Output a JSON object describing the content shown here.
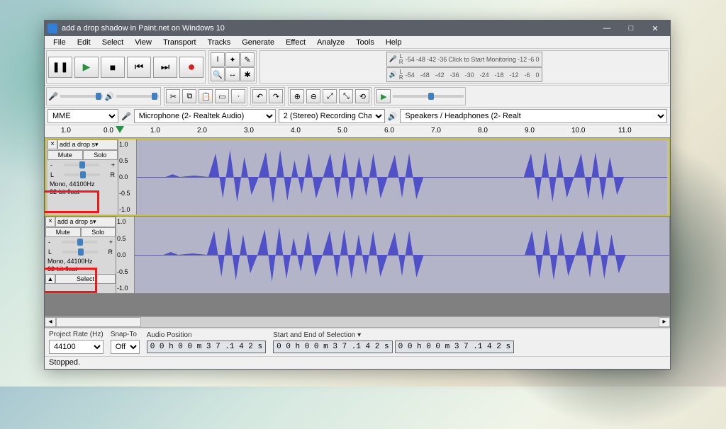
{
  "title": "add a drop shadow in Paint.net on Windows 10",
  "menu": [
    "File",
    "Edit",
    "Select",
    "View",
    "Transport",
    "Tracks",
    "Generate",
    "Effect",
    "Analyze",
    "Tools",
    "Help"
  ],
  "meter_ticks": [
    "-54",
    "-48",
    "-42",
    "-36",
    "-30",
    "-24",
    "-18",
    "-12",
    "-6",
    "0"
  ],
  "meter_click": "Click to Start Monitoring",
  "devices": {
    "host": "MME",
    "recdev": "Microphone (2- Realtek Audio)",
    "channels": "2 (Stereo) Recording Cha",
    "playdev": "Speakers / Headphones (2- Realt"
  },
  "ruler_range": {
    "start": 1.0,
    "end": 11.0,
    "major_step": 1.0
  },
  "ruler_labels": [
    "1.0",
    "0.0",
    "1.0",
    "2.0",
    "3.0",
    "4.0",
    "5.0",
    "6.0",
    "7.0",
    "8.0",
    "9.0",
    "10.0",
    "11.0"
  ],
  "track": {
    "name": "add a drop s",
    "mute": "Mute",
    "solo": "Solo",
    "pan_l": "L",
    "pan_r": "R",
    "format_l1": "Mono, 44100Hz",
    "format_l2": "32-bit float",
    "select": "Select"
  },
  "vscale": [
    "1.0",
    "0.5",
    "0.0",
    "-0.5",
    "-1.0"
  ],
  "selection": {
    "rate_label": "Project Rate (Hz)",
    "rate": "44100",
    "snap_label": "Snap-To",
    "snap": "Off",
    "audiopos_label": "Audio Position",
    "audiopos": "0 0 h 0 0 m 3 7 .1 4 2 s",
    "sel_label": "Start and End of Selection",
    "sel1": "0 0 h 0 0 m 3 7 .1 4 2 s",
    "sel2": "0 0 h 0 0 m 3 7 .1 4 2 s"
  },
  "status": "Stopped.",
  "icons": {
    "minimize": "—",
    "maximize": "□",
    "close": "✕",
    "pause": "❚❚",
    "play": "▶",
    "stop": "■",
    "skip_start": "⏮",
    "skip_end": "⏭",
    "record": "●",
    "mic": "🎤",
    "spk": "🔊",
    "ibeam": "I",
    "envelope": "✦",
    "draw": "✎",
    "zoom": "🔍",
    "timeshift": "↔",
    "multi": "✱",
    "cut": "✂",
    "copy": "⧉",
    "paste": "📋",
    "trim": "▭",
    "silence": "·",
    "undo": "↶",
    "redo": "↷",
    "zoomin": "⊕",
    "zoomout": "⊖",
    "fitsel": "⤢",
    "fitproj": "⤡",
    "zoomtoggle": "⟲",
    "play2": "▶"
  }
}
